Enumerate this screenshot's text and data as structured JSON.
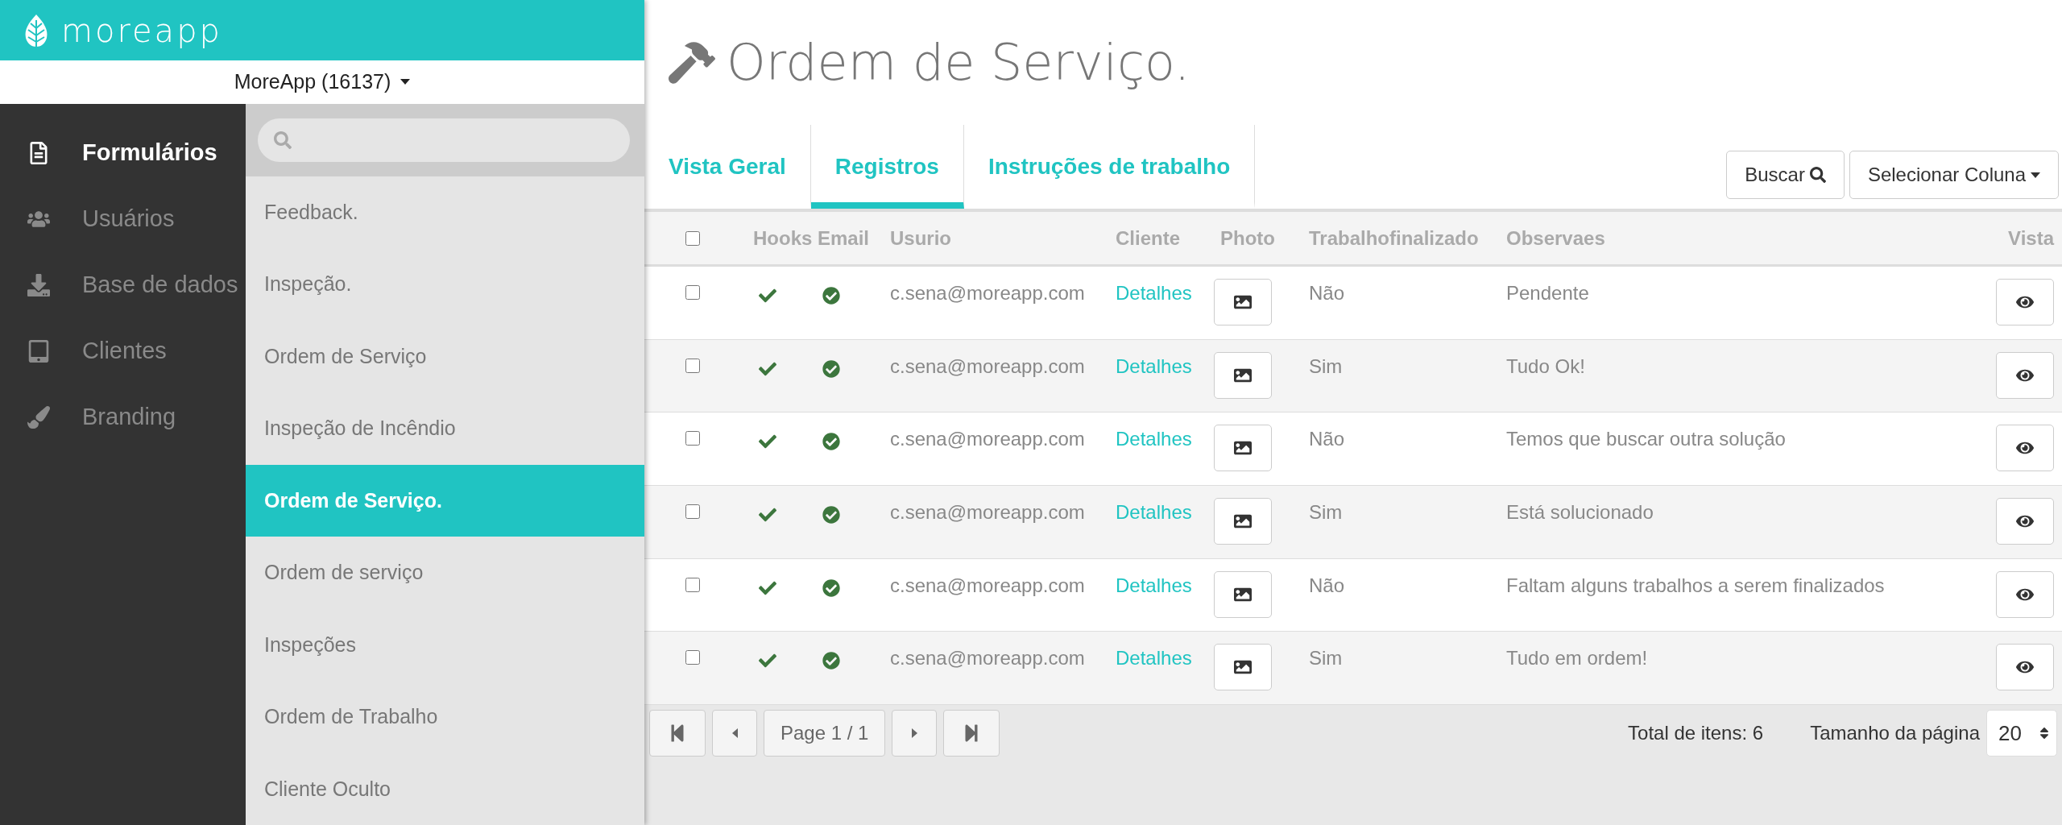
{
  "brand": {
    "name": "moreapp"
  },
  "account": {
    "label": "MoreApp (16137)"
  },
  "nav": [
    {
      "label": "Formulários",
      "selected": true
    },
    {
      "label": "Usuários",
      "selected": false
    },
    {
      "label": "Base de dados",
      "selected": false
    },
    {
      "label": "Clientes",
      "selected": false
    },
    {
      "label": "Branding",
      "selected": false
    }
  ],
  "forms": [
    {
      "label": "Feedback.",
      "selected": false
    },
    {
      "label": "Inspeção.",
      "selected": false
    },
    {
      "label": "Ordem de Serviço",
      "selected": false
    },
    {
      "label": "Inspeção de Incêndio",
      "selected": false
    },
    {
      "label": "Ordem de Serviço.",
      "selected": true
    },
    {
      "label": "Ordem de serviço",
      "selected": false
    },
    {
      "label": "Inspeções",
      "selected": false
    },
    {
      "label": "Ordem de Trabalho",
      "selected": false
    },
    {
      "label": "Cliente Oculto",
      "selected": false
    }
  ],
  "page": {
    "title": "Ordem de Serviço."
  },
  "tabs": [
    {
      "label": "Vista Geral",
      "selected": false
    },
    {
      "label": "Registros",
      "selected": true
    },
    {
      "label": "Instruções de trabalho",
      "selected": false
    }
  ],
  "toolbar": {
    "search_button": "Buscar",
    "column_button": "Selecionar Coluna"
  },
  "table": {
    "columns": [
      "Hooks",
      "Email",
      "Usurio",
      "Cliente",
      "Photo",
      "Trabalhofinalizado",
      "Observaes",
      "Vista"
    ],
    "all_checked": false,
    "rows": [
      {
        "checked": false,
        "hooks": true,
        "email": true,
        "user": "c.sena@moreapp.com",
        "client": "Detalhes",
        "finished": "Não",
        "notes": "Pendente"
      },
      {
        "checked": false,
        "hooks": true,
        "email": true,
        "user": "c.sena@moreapp.com",
        "client": "Detalhes",
        "finished": "Sim",
        "notes": "Tudo Ok!"
      },
      {
        "checked": false,
        "hooks": true,
        "email": true,
        "user": "c.sena@moreapp.com",
        "client": "Detalhes",
        "finished": "Não",
        "notes": "Temos que buscar outra solução"
      },
      {
        "checked": false,
        "hooks": true,
        "email": true,
        "user": "c.sena@moreapp.com",
        "client": "Detalhes",
        "finished": "Sim",
        "notes": "Está solucionado"
      },
      {
        "checked": false,
        "hooks": true,
        "email": true,
        "user": "c.sena@moreapp.com",
        "client": "Detalhes",
        "finished": "Não",
        "notes": "Faltam alguns trabalhos a serem finalizados"
      },
      {
        "checked": false,
        "hooks": true,
        "email": true,
        "user": "c.sena@moreapp.com",
        "client": "Detalhes",
        "finished": "Sim",
        "notes": "Tudo em ordem!"
      }
    ]
  },
  "pager": {
    "page": "Page 1 / 1",
    "total": "Total de itens: 6",
    "size_label": "Tamanho da página",
    "size": "20"
  }
}
